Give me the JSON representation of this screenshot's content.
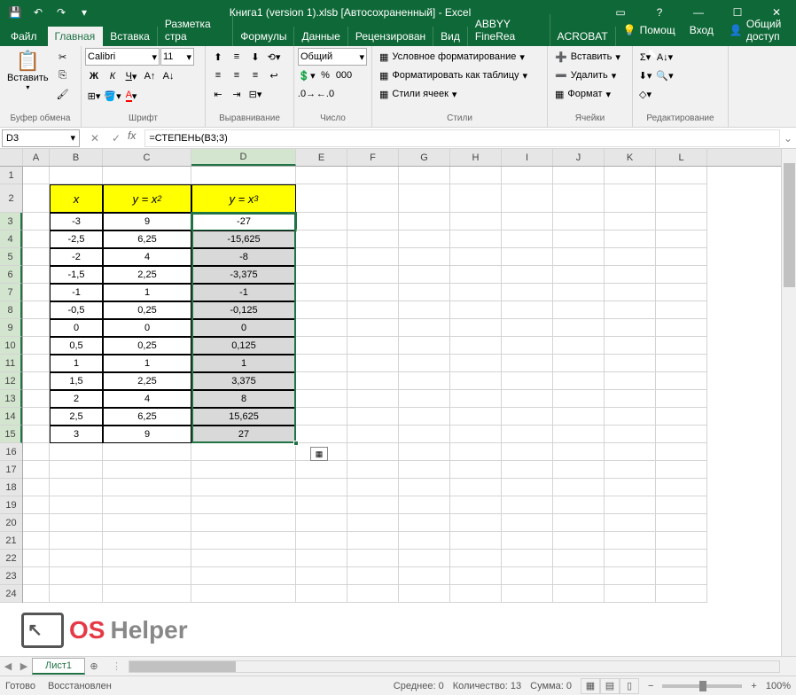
{
  "titlebar": {
    "title": "Книга1 (version 1).xlsb [Автосохраненный] - Excel"
  },
  "tabs": {
    "file": "Файл",
    "items": [
      "Главная",
      "Вставка",
      "Разметка стра",
      "Формулы",
      "Данные",
      "Рецензирован",
      "Вид",
      "ABBYY FineRea",
      "ACROBAT"
    ],
    "active": 0,
    "help": "Помощ",
    "login": "Вход",
    "share": "Общий доступ"
  },
  "ribbon": {
    "clipboard": {
      "paste": "Вставить",
      "label": "Буфер обмена"
    },
    "font": {
      "name": "Calibri",
      "size": "11",
      "label": "Шрифт"
    },
    "align": {
      "label": "Выравнивание"
    },
    "number": {
      "format": "Общий",
      "label": "Число"
    },
    "styles": {
      "cond": "Условное форматирование",
      "table": "Форматировать как таблицу",
      "cell": "Стили ячеек",
      "label": "Стили"
    },
    "cells": {
      "insert": "Вставить",
      "delete": "Удалить",
      "format": "Формат",
      "label": "Ячейки"
    },
    "editing": {
      "label": "Редактирование"
    }
  },
  "namebox": "D3",
  "formula": "=СТЕПЕНЬ(B3;3)",
  "columns": [
    "A",
    "B",
    "C",
    "D",
    "E",
    "F",
    "G",
    "H",
    "I",
    "J",
    "K",
    "L"
  ],
  "headers": {
    "x": "x",
    "y2": "y = x²",
    "y3": "y = x³"
  },
  "data": [
    {
      "x": "-3",
      "y2": "9",
      "y3": "-27"
    },
    {
      "x": "-2,5",
      "y2": "6,25",
      "y3": "-15,625"
    },
    {
      "x": "-2",
      "y2": "4",
      "y3": "-8"
    },
    {
      "x": "-1,5",
      "y2": "2,25",
      "y3": "-3,375"
    },
    {
      "x": "-1",
      "y2": "1",
      "y3": "-1"
    },
    {
      "x": "-0,5",
      "y2": "0,25",
      "y3": "-0,125"
    },
    {
      "x": "0",
      "y2": "0",
      "y3": "0"
    },
    {
      "x": "0,5",
      "y2": "0,25",
      "y3": "0,125"
    },
    {
      "x": "1",
      "y2": "1",
      "y3": "1"
    },
    {
      "x": "1,5",
      "y2": "2,25",
      "y3": "3,375"
    },
    {
      "x": "2",
      "y2": "4",
      "y3": "8"
    },
    {
      "x": "2,5",
      "y2": "6,25",
      "y3": "15,625"
    },
    {
      "x": "3",
      "y2": "9",
      "y3": "27"
    }
  ],
  "sheet": {
    "name": "Лист1"
  },
  "status": {
    "ready": "Готово",
    "recovered": "Восстановлен",
    "avg_label": "Среднее:",
    "avg": "0",
    "count_label": "Количество:",
    "count": "13",
    "sum_label": "Сумма:",
    "sum": "0",
    "zoom": "100%"
  },
  "watermark": {
    "os": "OS",
    "helper": "Helper"
  }
}
